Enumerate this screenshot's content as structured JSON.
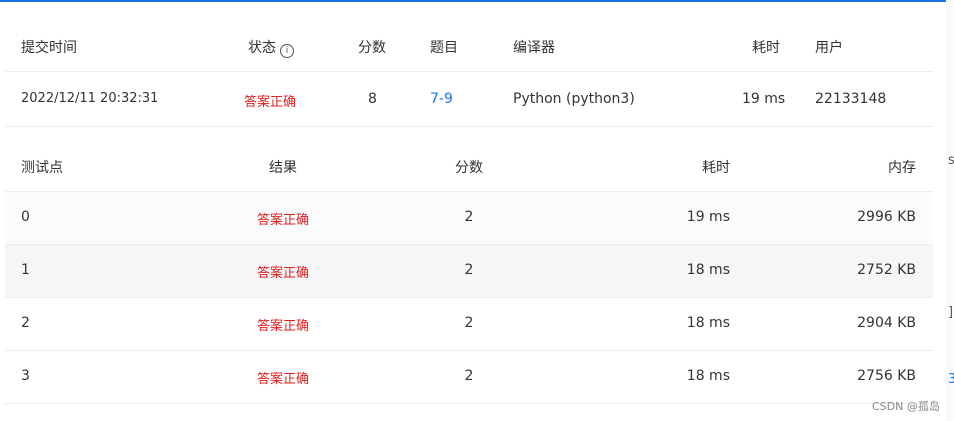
{
  "submission": {
    "headers": {
      "submit_time": "提交时间",
      "status": "状态",
      "score": "分数",
      "problem": "题目",
      "compiler": "编译器",
      "time": "耗时",
      "user": "用户"
    },
    "row": {
      "submit_time": "2022/12/11 20:32:31",
      "status": "答案正确",
      "score": "8",
      "problem": "7-9",
      "compiler": "Python (python3)",
      "time": "19 ms",
      "user": "22133148"
    }
  },
  "testcases": {
    "headers": {
      "case": "测试点",
      "result": "结果",
      "score": "分数",
      "time": "耗时",
      "memory": "内存"
    },
    "rows": [
      {
        "case": "0",
        "result": "答案正确",
        "score": "2",
        "time": "19 ms",
        "memory": "2996 KB"
      },
      {
        "case": "1",
        "result": "答案正确",
        "score": "2",
        "time": "18 ms",
        "memory": "2752 KB"
      },
      {
        "case": "2",
        "result": "答案正确",
        "score": "2",
        "time": "18 ms",
        "memory": "2904 KB"
      },
      {
        "case": "3",
        "result": "答案正确",
        "score": "2",
        "time": "18 ms",
        "memory": "2756 KB"
      }
    ]
  },
  "watermark": "CSDN @孤岛",
  "colors": {
    "accent": "#1a73e8",
    "success_text": "#e02020",
    "row_alt": "#f5f6f8"
  },
  "icons": {
    "status_info": "info-icon"
  }
}
